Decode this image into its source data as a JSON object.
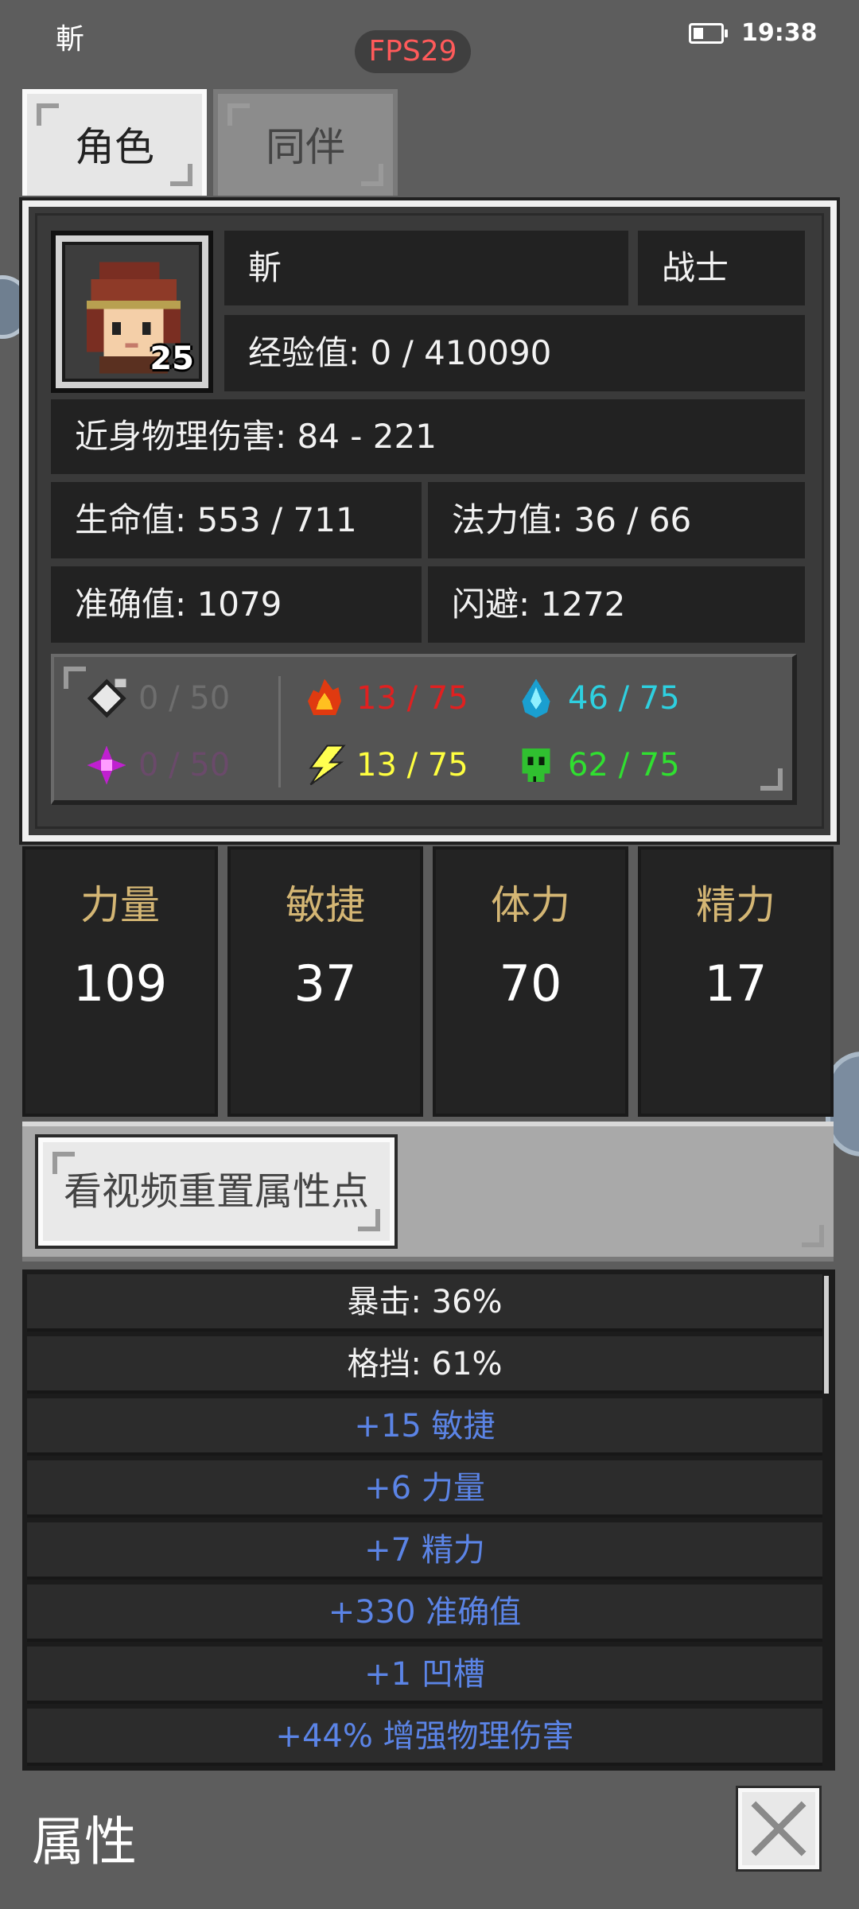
{
  "status_bar": {
    "left_text": "斬",
    "fps": "FPS29",
    "time": "19:38"
  },
  "tabs": [
    {
      "label": "角色",
      "active": true
    },
    {
      "label": "同伴",
      "active": false
    }
  ],
  "character": {
    "name": "斬",
    "class": "战士",
    "level": "25",
    "exp": "经验值: 0 / 410090",
    "melee_damage": "近身物理伤害: 84 - 221",
    "hp": "生命值: 553 / 711",
    "mp": "法力值: 36 / 66",
    "accuracy": "准确值: 1079",
    "dodge": "闪避: 1272"
  },
  "resistances": [
    {
      "icon": "physical-shield-icon",
      "text": "0 / 50",
      "color": "#6e6e6e"
    },
    {
      "icon": "fire-icon",
      "text": "13 / 75",
      "color": "#e02020"
    },
    {
      "icon": "water-drop-icon",
      "text": "46 / 75",
      "color": "#2ed0e0"
    },
    {
      "icon": "magic-star-icon",
      "text": "0 / 50",
      "color": "#6a4a6a"
    },
    {
      "icon": "lightning-icon",
      "text": "13 / 75",
      "color": "#ffff40"
    },
    {
      "icon": "poison-skull-icon",
      "text": "62 / 75",
      "color": "#30e030"
    }
  ],
  "attributes": [
    {
      "label": "力量",
      "value": "109"
    },
    {
      "label": "敏捷",
      "value": "37"
    },
    {
      "label": "体力",
      "value": "70"
    },
    {
      "label": "精力",
      "value": "17"
    }
  ],
  "reset_button": "看视频重置属性点",
  "bonus_list": [
    {
      "text": "暴击: 36%",
      "style": "white"
    },
    {
      "text": "格挡: 61%",
      "style": "white"
    },
    {
      "text": "+15 敏捷",
      "style": "blue"
    },
    {
      "text": "+6 力量",
      "style": "blue"
    },
    {
      "text": "+7 精力",
      "style": "blue"
    },
    {
      "text": "+330 准确值",
      "style": "blue"
    },
    {
      "text": "+1 凹槽",
      "style": "blue"
    },
    {
      "text": "+44% 增强物理伤害",
      "style": "blue"
    }
  ],
  "footer": {
    "title": "属性"
  }
}
